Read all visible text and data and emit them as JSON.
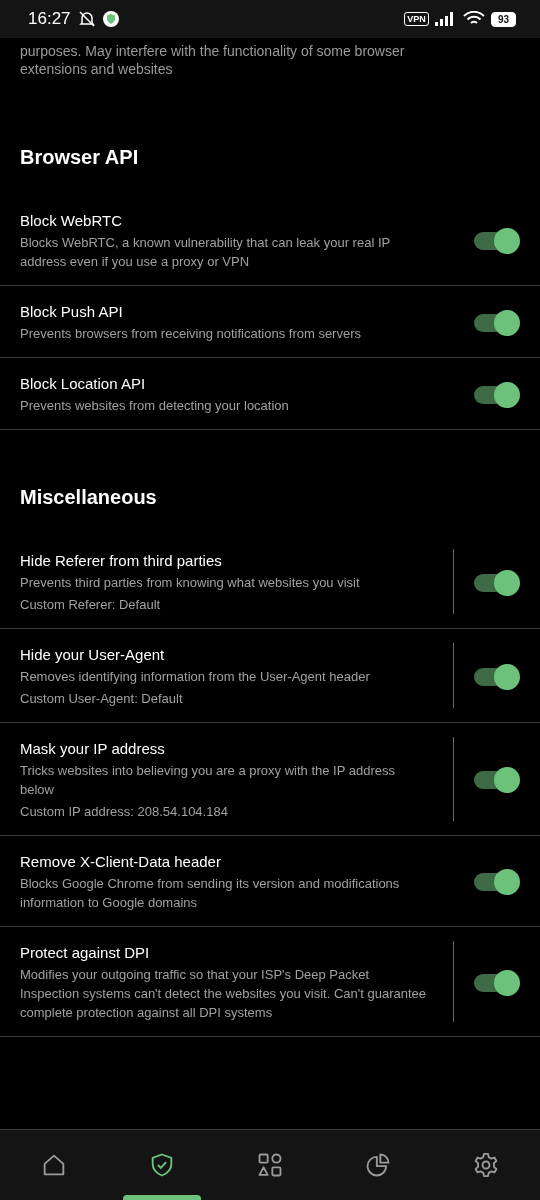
{
  "status_bar": {
    "time": "16:27",
    "vpn": "VPN",
    "battery": "93"
  },
  "intro": "purposes. May interfere with the functionality of some browser extensions and websites",
  "sections": [
    {
      "title": "Browser API",
      "items": [
        {
          "title": "Block WebRTC",
          "description": "Blocks WebRTC, a known vulnerability that can leak your real IP address even if you use a proxy or VPN",
          "on": true,
          "configurable": false
        },
        {
          "title": "Block Push API",
          "description": "Prevents browsers from receiving notifications from servers",
          "on": true,
          "configurable": false
        },
        {
          "title": "Block Location API",
          "description": "Prevents websites from detecting your location",
          "on": true,
          "configurable": false
        }
      ]
    },
    {
      "title": "Miscellaneous",
      "items": [
        {
          "title": "Hide Referer from third parties",
          "description": "Prevents third parties from knowing what websites you visit",
          "extra": "Custom Referer: Default",
          "on": true,
          "configurable": true
        },
        {
          "title": "Hide your User-Agent",
          "description": "Removes identifying information from the User-Agent header",
          "extra": "Custom User-Agent: Default",
          "on": true,
          "configurable": true
        },
        {
          "title": "Mask your IP address",
          "description": "Tricks websites into believing you are a proxy with the IP address below",
          "extra": "Custom IP address: 208.54.104.184",
          "on": true,
          "configurable": true
        },
        {
          "title": "Remove X-Client-Data header",
          "description": "Blocks Google Chrome from sending its version and modifications information to Google domains",
          "on": true,
          "configurable": false
        },
        {
          "title": "Protect against DPI",
          "description": "Modifies your outgoing traffic so that your ISP's Deep Packet Inspection systems can't detect the websites you visit. Can't guarantee complete protection against all DPI systems",
          "on": true,
          "configurable": true
        }
      ]
    }
  ],
  "nav": [
    {
      "kind": "home",
      "selected": false
    },
    {
      "kind": "protection",
      "selected": true
    },
    {
      "kind": "apps",
      "selected": false
    },
    {
      "kind": "stats",
      "selected": false
    },
    {
      "kind": "settings",
      "selected": false
    }
  ]
}
